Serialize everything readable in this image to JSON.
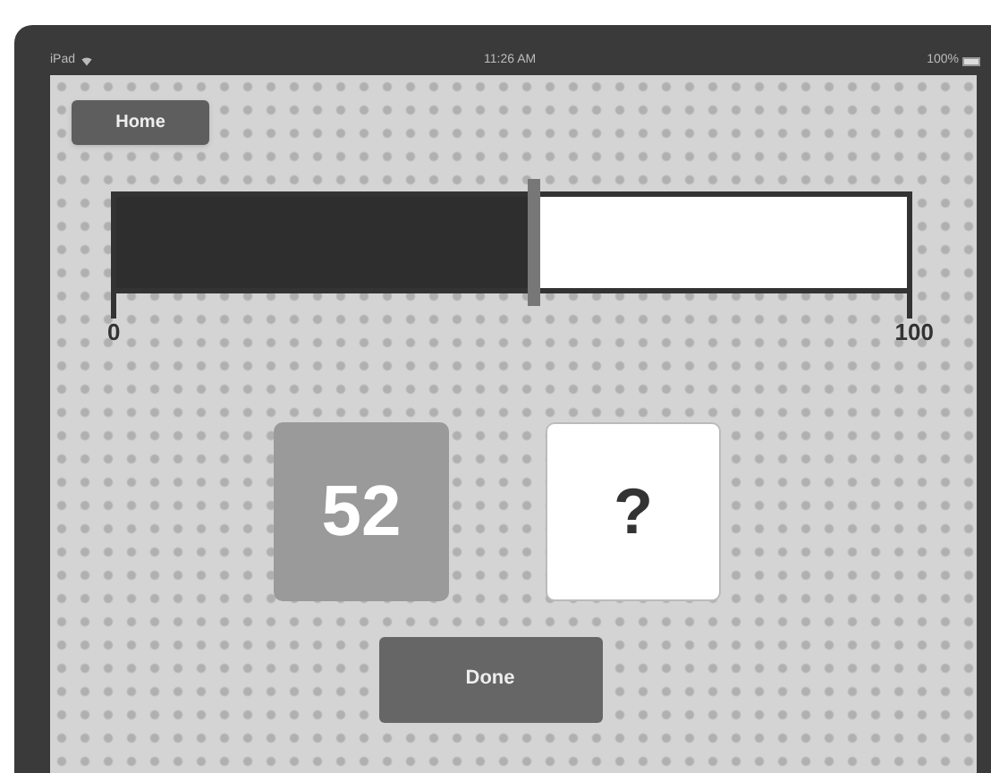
{
  "status_bar": {
    "device": "iPad",
    "time": "11:26 AM",
    "battery": "100%"
  },
  "home_button": {
    "label": "Home"
  },
  "slider": {
    "level": 0.53,
    "min_label": "0",
    "max_label": "100"
  },
  "cards": [
    {
      "kind": "number",
      "text": "52"
    },
    {
      "kind": "unknown",
      "text": "?"
    }
  ],
  "done_button": {
    "label": "Done"
  }
}
